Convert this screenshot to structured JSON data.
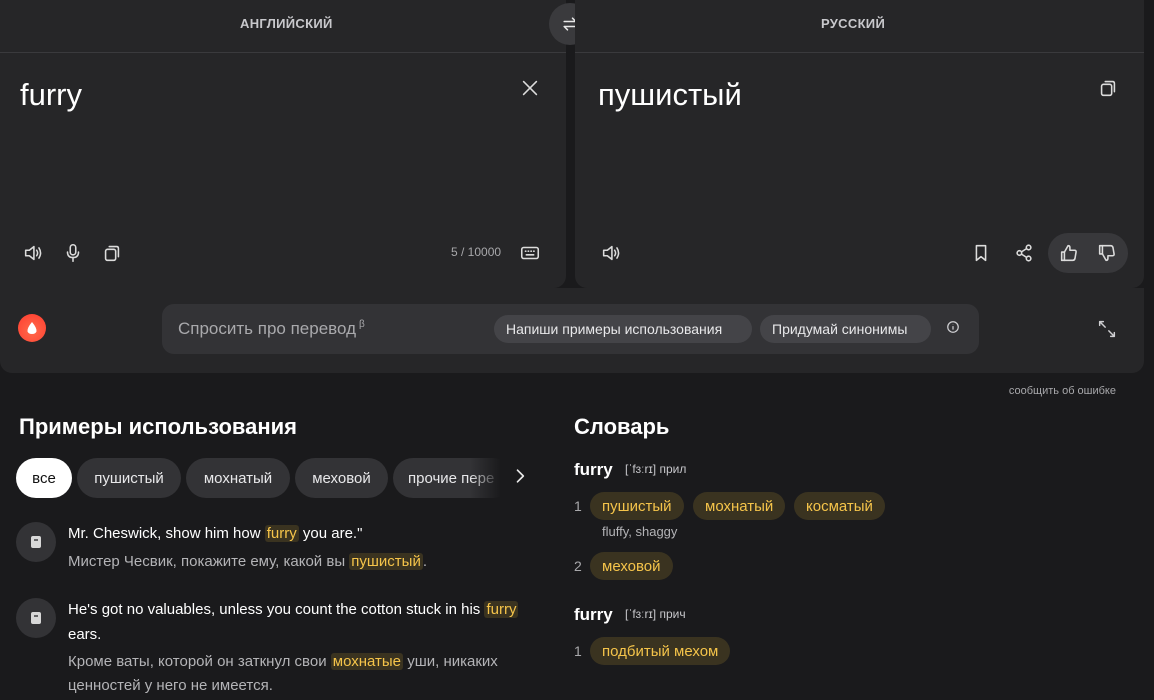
{
  "translator": {
    "source_lang": "АНГЛИЙСКИЙ",
    "target_lang": "РУССКИЙ",
    "source_text": "furry",
    "target_text": "пушистый",
    "char_count": "5 / 10000"
  },
  "assistant": {
    "placeholder": "Спросить про перевод",
    "beta_mark": "β",
    "suggestions": [
      "Напиши примеры использования",
      "Придумай синонимы"
    ],
    "report_link": "сообщить об ошибке"
  },
  "examples": {
    "title": "Примеры использования",
    "filters": [
      "все",
      "пушистый",
      "мохнатый",
      "меховой",
      "прочие пере"
    ],
    "items": [
      {
        "src_before": "Mr. Cheswick, show him how ",
        "src_hl": "furry",
        "src_after": " you are.\"",
        "tr_before": "Мистер Чесвик, покажите ему, какой вы ",
        "tr_hl": "пушистый",
        "tr_after": "."
      },
      {
        "src_before": "He's got no valuables, unless you count the cotton stuck in his ",
        "src_hl": "furry",
        "src_after": " ears.",
        "tr_before": "Кроме ваты, которой он заткнул свои ",
        "tr_hl": "мохнатые",
        "tr_after": " уши, никаких ценностей у него не имеется."
      }
    ]
  },
  "dictionary": {
    "title": "Словарь",
    "entries": [
      {
        "word": "furry",
        "transcription": "[ˈfɜːrɪ]",
        "pos": "прил",
        "senses": [
          {
            "num": "1",
            "translations": [
              "пушистый",
              "мохнатый",
              "косматый"
            ],
            "synonyms": "fluffy, shaggy"
          },
          {
            "num": "2",
            "translations": [
              "меховой"
            ]
          }
        ]
      },
      {
        "word": "furry",
        "transcription": "[ˈfɜːrɪ]",
        "pos": "прич",
        "senses": [
          {
            "num": "1",
            "translations": [
              "подбитый мехом"
            ]
          }
        ]
      }
    ]
  },
  "colors": {
    "background": "#1a1a1c",
    "panel": "#262628",
    "highlight_text": "#f5c44a",
    "highlight_bg": "#3a3320",
    "alice_brand": "#ff3b2f"
  }
}
